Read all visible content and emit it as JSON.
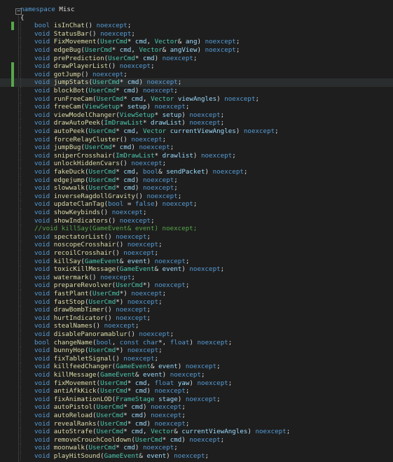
{
  "editor": {
    "namespace_keyword": "namespace",
    "namespace_name": "Misc",
    "open_brace": "{",
    "fold_icon": "minus-square-icon",
    "colors": {
      "background": "#1e1e1e",
      "keyword": "#569cd6",
      "type": "#4ec9b0",
      "function": "#dcdcaa",
      "parameter": "#9cdcfe",
      "comment": "#57a64a",
      "change_marker": "#57a64a"
    },
    "lines": [
      "bool isInChat() noexcept;",
      "void StatusBar() noexcept;",
      "void FixMovement(UserCmd* cmd, Vector& ang) noexcept;",
      "void edgeBug(UserCmd* cmd, Vector& angView) noexcept;",
      "void prePrediction(UserCmd* cmd) noexcept;",
      "void drawPlayerList() noexcept;",
      "void gotJump() noexcept;",
      "void jumpStats(UserCmd* cmd) noexcept;",
      "void blockBot(UserCmd* cmd) noexcept;",
      "void runFreeCam(UserCmd* cmd, Vector viewAngles) noexcept;",
      "void freeCam(ViewSetup* setup) noexcept;",
      "void viewModelChanger(ViewSetup* setup) noexcept;",
      "void drawAutoPeek(ImDrawList* drawList) noexcept;",
      "void autoPeek(UserCmd* cmd, Vector currentViewAngles) noexcept;",
      "void forceRelayCluster() noexcept;",
      "void jumpBug(UserCmd* cmd) noexcept;",
      "void sniperCrosshair(ImDrawList* drawlist) noexcept;",
      "void unlockHiddenCvars() noexcept;",
      "void fakeDuck(UserCmd* cmd, bool& sendPacket) noexcept;",
      "void edgejump(UserCmd* cmd) noexcept;",
      "void slowwalk(UserCmd* cmd) noexcept;",
      "void inverseRagdollGravity() noexcept;",
      "void updateClanTag(bool = false) noexcept;",
      "void showKeybinds() noexcept;",
      "void showIndicators() noexcept;",
      "//void killSay(GameEvent& event) noexcept;",
      "void spectatorList() noexcept;",
      "void noscopeCrosshair() noexcept;",
      "void recoilCrosshair() noexcept;",
      "void killSay(GameEvent& event) noexcept;",
      "void toxicKillMessage(GameEvent& event) noexcept;",
      "void watermark() noexcept;",
      "void prepareRevolver(UserCmd*) noexcept;",
      "void fastPlant(UserCmd*) noexcept;",
      "void fastStop(UserCmd*) noexcept;",
      "void drawBombTimer() noexcept;",
      "void hurtIndicator() noexcept;",
      "void stealNames() noexcept;",
      "void disablePanoramablur() noexcept;",
      "bool changeName(bool, const char*, float) noexcept;",
      "void bunnyHop(UserCmd*) noexcept;",
      "void fixTabletSignal() noexcept;",
      "void killfeedChanger(GameEvent& event) noexcept;",
      "void killMessage(GameEvent& event) noexcept;",
      "void fixMovement(UserCmd* cmd, float yaw) noexcept;",
      "void antiAfkKick(UserCmd* cmd) noexcept;",
      "void fixAnimationLOD(FrameStage stage) noexcept;",
      "void autoPistol(UserCmd* cmd) noexcept;",
      "void autoReload(UserCmd* cmd) noexcept;",
      "void revealRanks(UserCmd* cmd) noexcept;",
      "void autoStrafe(UserCmd* cmd, Vector& currentViewAngles) noexcept;",
      "void removeCrouchCooldown(UserCmd* cmd) noexcept;",
      "void moonwalk(UserCmd* cmd) noexcept;",
      "void playHitSound(GameEvent& event) noexcept;"
    ],
    "changed_lines": [
      0,
      5,
      6,
      7
    ],
    "highlighted_line": 7
  }
}
